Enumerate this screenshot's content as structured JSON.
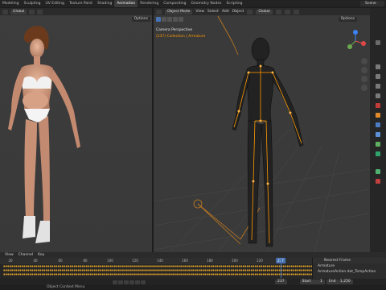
{
  "menu": {
    "tabs": [
      "Modeling",
      "Sculpting",
      "UV Editing",
      "Texture Paint",
      "Shading",
      "Animation",
      "Rendering",
      "Compositing",
      "Geometry Nodes",
      "Scripting"
    ],
    "active_tab": "Animation",
    "scene": "Scene"
  },
  "left_viewport": {
    "orientation": "Global",
    "options": "Options"
  },
  "right_viewport": {
    "mode": "Object Mode",
    "menus": [
      "View",
      "Select",
      "Add",
      "Object"
    ],
    "orientation": "Global",
    "camera_label": "Camera Perspective",
    "collection_label": "(237) Collection | Armature",
    "options": "Options"
  },
  "timeline": {
    "menus": [
      "View",
      "Channel",
      "Key"
    ],
    "ticks": [
      20,
      40,
      60,
      80,
      100,
      120,
      140,
      160,
      180,
      200,
      220
    ],
    "current_frame": "237",
    "frame_field": "237",
    "start_label": "Start",
    "start_value": "1",
    "end_label": "End",
    "end_value": "1,250",
    "status": "Object Context Menu"
  },
  "nla": {
    "interpolation": "Nearest Frame",
    "object": "Armature",
    "action": "ArmatureAction.dot_TempAction"
  },
  "colors": {
    "accent": "#4772b3",
    "armature": "#ff9900",
    "keyframe": "#e0a32b"
  }
}
